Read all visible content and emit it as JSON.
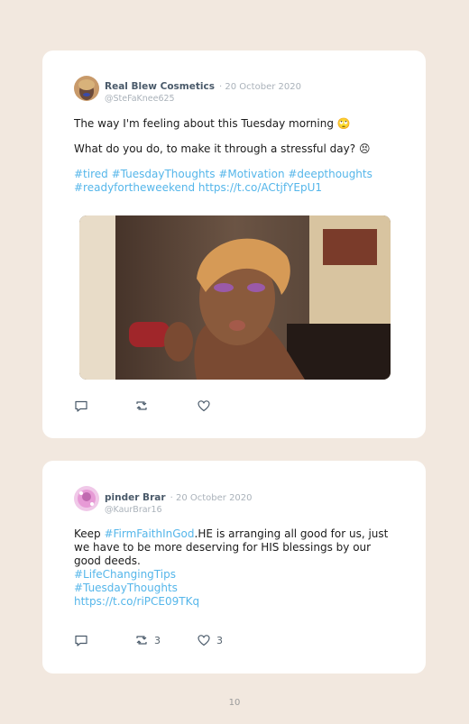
{
  "tweets": [
    {
      "name": "Real Blew Cosmetics",
      "date": "· 20 October 2020",
      "handle": "@SteFaKnee625",
      "line1": "The way I'm feeling about this Tuesday morning",
      "line1_emoji": "🙄",
      "line2": "What do you do, to make it through a stressful day?",
      "line2_emoji": "😣",
      "tags_line1": "#tired #TuesdayThoughts #Motivation #deepthoughts",
      "tags_line2": "#readyfortheweekend https://t.co/ACtjfYEpU1",
      "reply_count": "",
      "retweet_count": "",
      "like_count": ""
    },
    {
      "name": "pinder Brar",
      "date": "· 20 October 2020",
      "handle": "@KaurBrar16",
      "text_pre": "Keep ",
      "text_tag": "#FirmFaithInGod",
      "text_post": ".HE is arranging all good for us, just we have to be more deserving for HIS blessings by our good deeds.",
      "tag1": "#LifeChangingTips",
      "tag2": "#TuesdayThoughts",
      "link": "https://t.co/riPCE09TKq",
      "reply_count": "",
      "retweet_count": "3",
      "like_count": "3"
    }
  ],
  "page_number": "10",
  "icons": {
    "reply": "reply-icon",
    "retweet": "retweet-icon",
    "like": "heart-icon"
  },
  "colors": {
    "background": "#f2e8df",
    "card": "#ffffff",
    "link": "#55b6ea",
    "meta": "#aab2ba"
  }
}
